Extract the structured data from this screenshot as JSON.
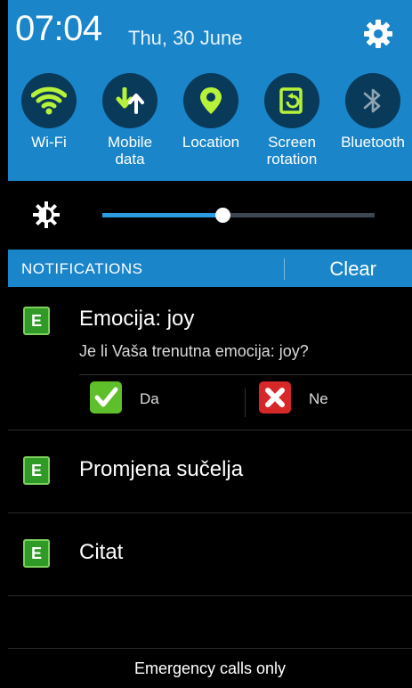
{
  "status": {
    "time": "07:04",
    "date": "Thu, 30 June"
  },
  "toggles": [
    {
      "label": "Wi-Fi",
      "icon": "wifi-icon"
    },
    {
      "label": "Mobile\ndata",
      "icon": "mobile-data-icon"
    },
    {
      "label": "Location",
      "icon": "location-icon"
    },
    {
      "label": "Screen\nrotation",
      "icon": "screen-rotation-icon"
    },
    {
      "label": "Bluetooth",
      "icon": "bluetooth-icon"
    }
  ],
  "brightness": {
    "level": 0.44
  },
  "notifications_header": {
    "title": "NOTIFICATIONS",
    "clear_label": "Clear"
  },
  "notifications": [
    {
      "app_badge": "E",
      "title": "Emocija: joy",
      "subtitle": "Je li Vaša trenutna emocija: joy?",
      "actions": [
        {
          "label": "Da",
          "icon": "check-icon",
          "color": "#5fbf2a"
        },
        {
          "label": "Ne",
          "icon": "x-icon",
          "color": "#d62828"
        }
      ]
    },
    {
      "app_badge": "E",
      "title": "Promjena sučelja"
    },
    {
      "app_badge": "E",
      "title": "Citat"
    }
  ],
  "footer": {
    "text": "Emergency calls only"
  },
  "colors": {
    "panel": "#1a85c9",
    "accent": "#2a9cdf",
    "badge_green": "#2f9a26"
  }
}
